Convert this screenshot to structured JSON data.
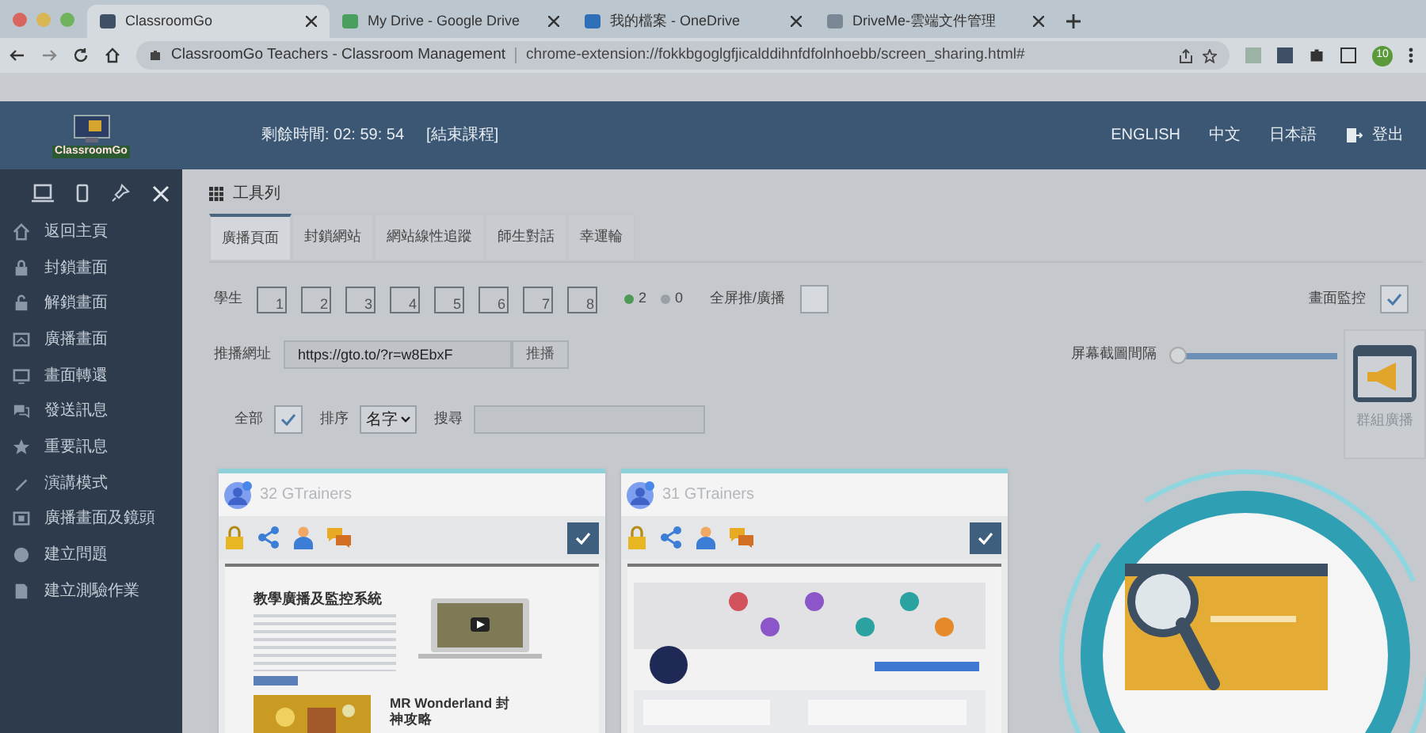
{
  "browser": {
    "tabs": [
      {
        "title": "ClassroomGo",
        "selected": true
      },
      {
        "title": "My Drive - Google Drive",
        "selected": false
      },
      {
        "title": "我的檔案 - OneDrive",
        "selected": false
      },
      {
        "title": "DriveMe-雲端文件管理",
        "selected": false
      }
    ],
    "page_title": "ClassroomGo Teachers - Classroom Management",
    "url": "chrome-extension://fokkbgoglgfjicalddihnfdfolnhoebb/screen_sharing.html#",
    "profile": "10"
  },
  "header": {
    "logo_text": "ClassroomGo",
    "timer": "剩餘時間: 02: 59: 54",
    "end_class": "[結束課程]",
    "languages": [
      "ENGLISH",
      "中文",
      "日本語"
    ],
    "logout": "登出"
  },
  "sidebar": {
    "items": [
      {
        "label": "返回主頁"
      },
      {
        "label": "封鎖畫面"
      },
      {
        "label": "解鎖畫面"
      },
      {
        "label": "廣播畫面"
      },
      {
        "label": "畫面轉還"
      },
      {
        "label": "發送訊息"
      },
      {
        "label": "重要訊息"
      },
      {
        "label": "演講模式"
      },
      {
        "label": "廣播畫面及鏡頭"
      },
      {
        "label": "建立問題"
      },
      {
        "label": "建立測驗作業"
      }
    ]
  },
  "toolbar": {
    "title": "工具列",
    "tabs": [
      {
        "label": "廣播頁面",
        "selected": true
      },
      {
        "label": "封鎖網站",
        "selected": false
      },
      {
        "label": "網站線性追蹤",
        "selected": false
      },
      {
        "label": "師生對話",
        "selected": false
      },
      {
        "label": "幸運輪",
        "selected": false
      }
    ]
  },
  "students": {
    "label": "學生",
    "layouts": [
      "1",
      "2",
      "3",
      "4",
      "5",
      "6",
      "7",
      "8"
    ],
    "online": "2",
    "offline": "0",
    "fullscreen_label": "全屏推/廣播",
    "fullscreen_checked": false,
    "monitor_label": "畫面監控",
    "monitor_checked": true
  },
  "push": {
    "label": "推播網址",
    "value": "https://gto.to/?r=w8EbxF",
    "button": "推播"
  },
  "interval": {
    "label": "屏幕截圖間隔",
    "level": 0
  },
  "filters": {
    "all_label": "全部",
    "all_checked": true,
    "sort_label": "排序",
    "sort_value": "名字",
    "search_label": "搜尋"
  },
  "group_broadcast": {
    "label": "群組廣播"
  },
  "cards": [
    {
      "name": "32 GTrainers",
      "checked": true,
      "preview": {
        "headline": "教學廣播及監控系統",
        "second": "MR Wonderland 封神攻略"
      }
    },
    {
      "name": "31 GTrainers",
      "checked": true
    }
  ]
}
